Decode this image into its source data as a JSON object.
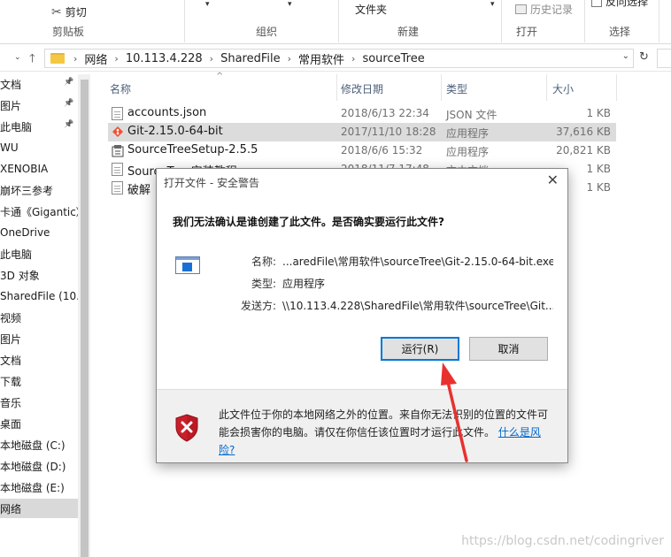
{
  "ribbon": {
    "clipboard_group": "剪贴板",
    "cut": "剪切",
    "organize_group": "组织",
    "new_folder": "文件夹",
    "new_group": "新建",
    "history": "历史记录",
    "open_group": "打开",
    "invert_selection": "反向选择",
    "select_group": "选择"
  },
  "address": {
    "crumbs": [
      "网络",
      "10.113.4.228",
      "SharedFile",
      "常用软件",
      "sourceTree"
    ]
  },
  "sidebar": {
    "items": [
      {
        "label": "文档",
        "pinned": true
      },
      {
        "label": "图片",
        "pinned": true
      },
      {
        "label": "此电脑",
        "pinned": true
      },
      {
        "label": "WU",
        "pinned": false
      },
      {
        "label": "XENOBIA",
        "pinned": false
      },
      {
        "label": "崩坏三参考",
        "pinned": false
      },
      {
        "label": "卡通《Gigantic》",
        "pinned": false
      },
      {
        "label": "OneDrive",
        "pinned": false
      },
      {
        "label": "此电脑",
        "pinned": false
      },
      {
        "label": "3D 对象",
        "pinned": false
      },
      {
        "label": "SharedFile (10.",
        "pinned": false
      },
      {
        "label": "视频",
        "pinned": false
      },
      {
        "label": "图片",
        "pinned": false
      },
      {
        "label": "文档",
        "pinned": false
      },
      {
        "label": "下载",
        "pinned": false
      },
      {
        "label": "音乐",
        "pinned": false
      },
      {
        "label": "桌面",
        "pinned": false
      },
      {
        "label": "本地磁盘 (C:)",
        "pinned": false
      },
      {
        "label": "本地磁盘 (D:)",
        "pinned": false
      },
      {
        "label": "本地磁盘 (E:)",
        "pinned": false
      },
      {
        "label": "网络",
        "pinned": false
      }
    ]
  },
  "columns": {
    "name": "名称",
    "date": "修改日期",
    "type": "类型",
    "size": "大小"
  },
  "files": [
    {
      "name": "accounts.json",
      "date": "2018/6/13 22:34",
      "type": "JSON 文件",
      "size": "1 KB",
      "icon": "json-file-icon"
    },
    {
      "name": "Git-2.15.0-64-bit",
      "date": "2017/11/10 18:28",
      "type": "应用程序",
      "size": "37,616 KB",
      "icon": "git-app-icon"
    },
    {
      "name": "SourceTreeSetup-2.5.5",
      "date": "2018/6/6 15:32",
      "type": "应用程序",
      "size": "20,821 KB",
      "icon": "installer-icon"
    },
    {
      "name": "SourceTree安装教程",
      "date": "2018/11/7 17:48",
      "type": "文本文档",
      "size": "1 KB",
      "icon": "text-file-icon"
    },
    {
      "name": "破解",
      "date": "",
      "type": "",
      "size": "1 KB",
      "icon": "text-file-icon"
    }
  ],
  "dialog": {
    "title": "打开文件 - 安全警告",
    "question": "我们无法确认是谁创建了此文件。是否确实要运行此文件?",
    "name_label": "名称:",
    "name_value": "...aredFile\\常用软件\\sourceTree\\Git-2.15.0-64-bit.exe",
    "type_label": "类型:",
    "type_value": "应用程序",
    "from_label": "发送方:",
    "from_value": "\\\\10.113.4.228\\SharedFile\\常用软件\\sourceTree\\Git...",
    "run_button": "运行(R)",
    "cancel_button": "取消",
    "warning_text": "此文件位于你的本地网络之外的位置。来自你无法识别的位置的文件可能会损害你的电脑。请仅在你信任该位置时才运行此文件。",
    "risk_link": "什么是风险?"
  },
  "watermark": "https://blog.csdn.net/codingriver",
  "colors": {
    "accent": "#0078d7",
    "annotation_arrow": "#e8312f",
    "selected_row": "#dcdcdc"
  }
}
